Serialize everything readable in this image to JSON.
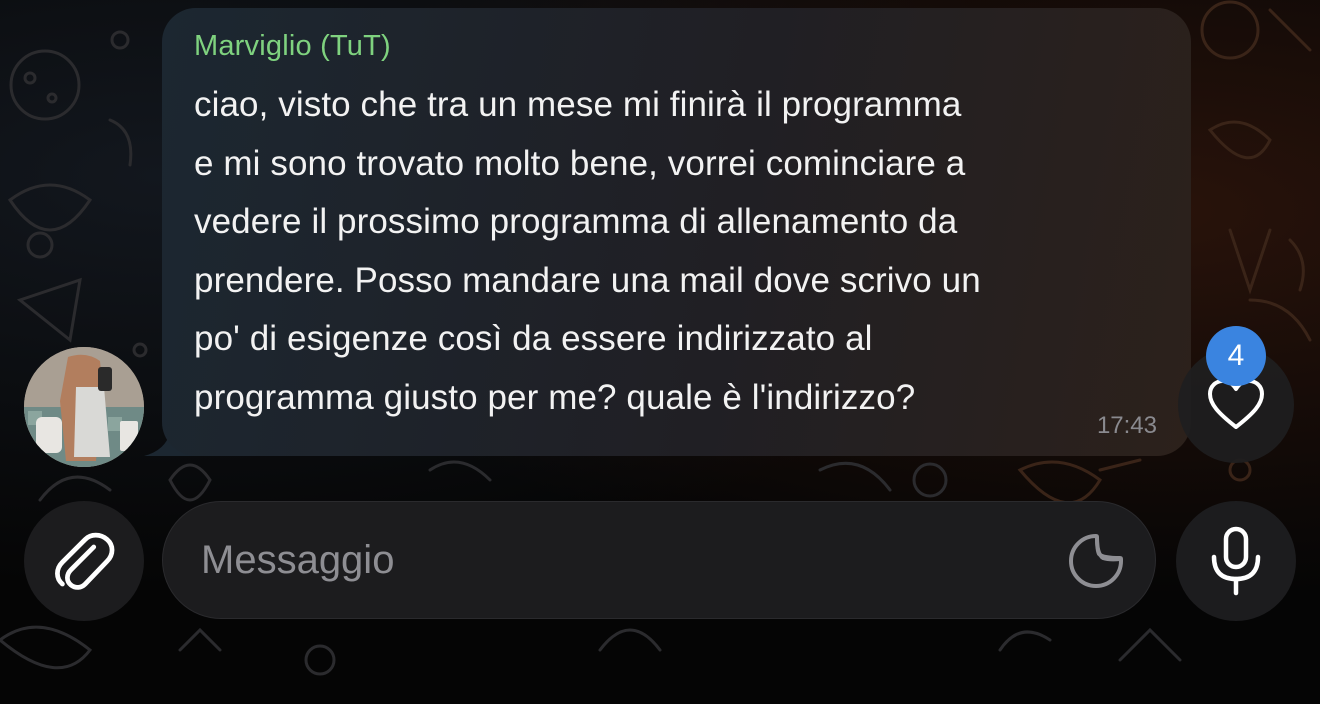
{
  "chat": {
    "message": {
      "sender": "Marviglio (TuT)",
      "lines": [
        "ciao, visto che tra un mese mi finirà il programma",
        "e mi sono trovato molto bene, vorrei cominciare a",
        "vedere il prossimo programma di allenamento da",
        "prendere. Posso mandare una mail dove scrivo un",
        "po' di esigenze così da essere indirizzato al",
        "programma giusto per me? quale è l'indirizzo?"
      ],
      "time": "17:43"
    },
    "reaction": {
      "count": "4",
      "icon": "heart-icon"
    }
  },
  "composer": {
    "placeholder": "Messaggio",
    "attach_icon": "paperclip-icon",
    "sticker_icon": "sticker-icon",
    "mic_icon": "microphone-icon"
  },
  "colors": {
    "sender_name": "#7fd27f",
    "badge": "#3a84e0",
    "background": "#000000"
  }
}
